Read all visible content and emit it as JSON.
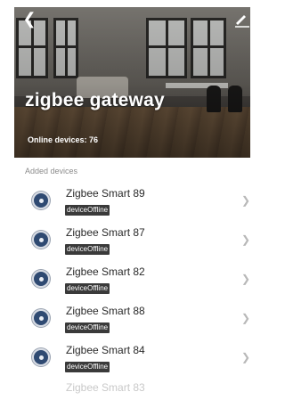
{
  "header": {
    "back_icon": "chevron-left-icon",
    "edit_icon": "pencil-icon",
    "title": "zigbee gateway",
    "online_devices": "Online devices: 76"
  },
  "section": {
    "label": "Added devices"
  },
  "devices": [
    {
      "name": "Zigbee Smart 89",
      "status": "deviceOffline"
    },
    {
      "name": "Zigbee Smart 87",
      "status": "deviceOffline"
    },
    {
      "name": "Zigbee Smart 82",
      "status": "deviceOffline"
    },
    {
      "name": "Zigbee Smart 88",
      "status": "deviceOffline"
    },
    {
      "name": "Zigbee Smart 84",
      "status": "deviceOffline"
    }
  ],
  "partial_device": {
    "name": "Zigbee Smart 83"
  },
  "colors": {
    "badge_bg": "#3a3a3a",
    "icon_bg": "#2f4a72"
  }
}
